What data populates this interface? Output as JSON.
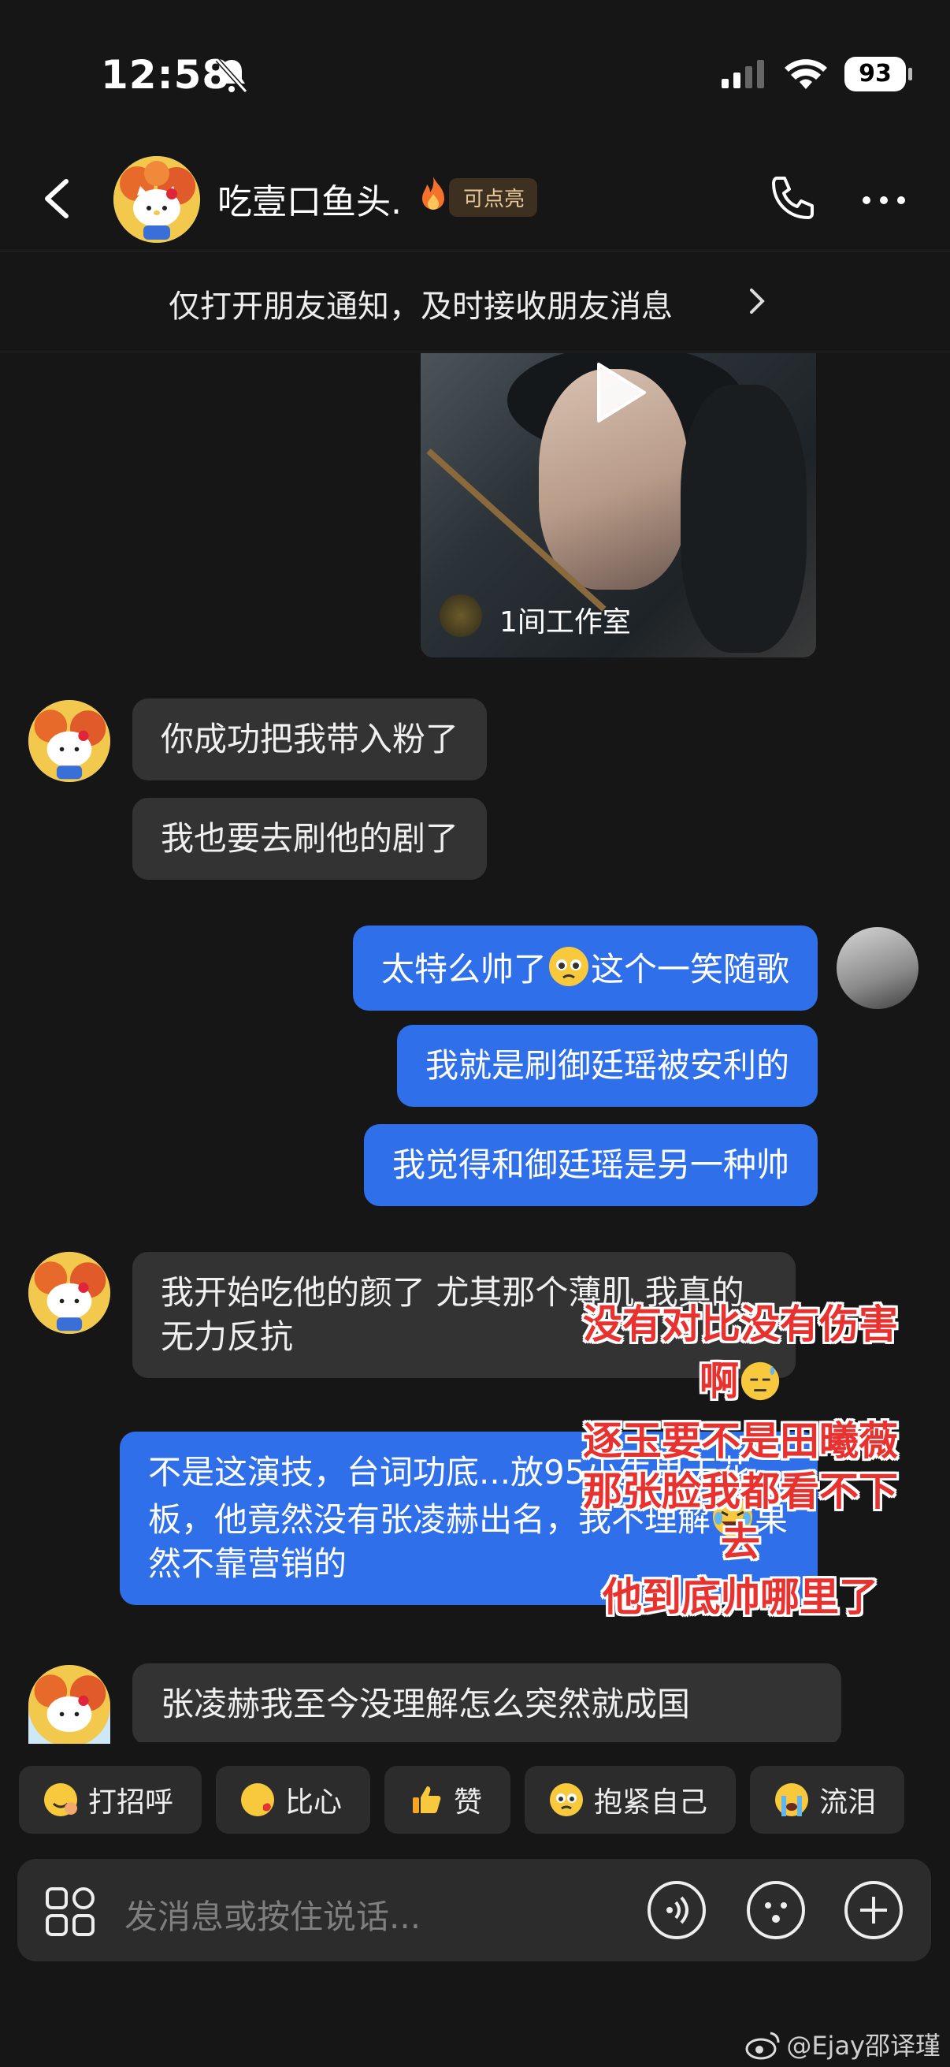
{
  "status": {
    "time": "12:58",
    "battery": "93"
  },
  "header": {
    "name": "吃壹口鱼头.",
    "badge": "可点亮"
  },
  "notify": {
    "text": "仅打开朋友通知，及时接收朋友消息"
  },
  "video": {
    "label": "1间工作室"
  },
  "messages": {
    "m1": "你成功把我带入粉了",
    "m2": "我也要去刷他的剧了",
    "m3a": "太特么帅了",
    "m3b": "这个一笑随歌",
    "m4": "我就是刷御廷瑶被安利的",
    "m5": "我觉得和御廷瑶是另一种帅",
    "m6": "我开始吃他的颜了 尤其那个薄肌 我真的无力反抗",
    "m7a": "不是这演技，台词功底...放95小生里天花板，他竟然没有张凌赫出名，我不理解",
    "m7b": "果然不靠营销的",
    "m8": "张凌赫我至今没理解怎么突然就成国"
  },
  "overlay": {
    "line1": "没有对比没有伤害",
    "line2": "啊",
    "line3": "逐玉要不是田曦薇",
    "line4": "那张脸我都看不下",
    "line5": "去",
    "line6": "他到底帅哪里了"
  },
  "quick_replies": [
    "打招呼",
    "比心",
    "赞",
    "抱紧自己",
    "流泪"
  ],
  "input": {
    "placeholder": "发消息或按住说话..."
  },
  "watermark": "@Ejay邵译瑾"
}
